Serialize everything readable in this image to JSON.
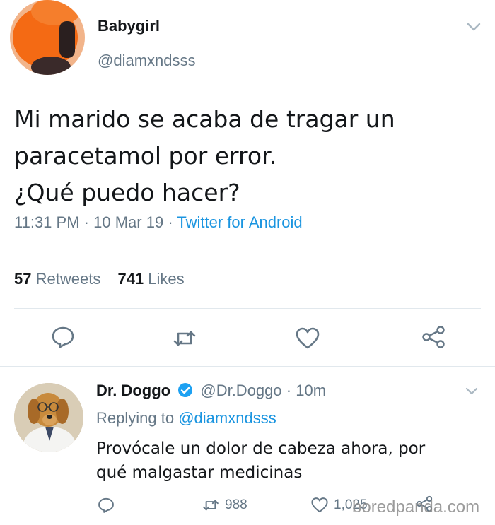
{
  "tweet": {
    "author_name": "Babygirl",
    "author_handle": "@diamxndsss",
    "text_lines": [
      "Mi marido se acaba de tragar un",
      "paracetamol por error.",
      "¿Qué puedo hacer?"
    ],
    "time": "11:31 PM",
    "date": "10 Mar 19",
    "source": "Twitter for Android",
    "separator": "·",
    "retweets_count": "57",
    "retweets_label": "Retweets",
    "likes_count": "741",
    "likes_label": "Likes",
    "avatar_icon": "profile-photo-redacted"
  },
  "actions": {
    "reply_icon": "reply-icon",
    "retweet_icon": "retweet-icon",
    "like_icon": "heart-icon",
    "share_icon": "share-icon"
  },
  "reply": {
    "author_name": "Dr. Doggo",
    "author_handle": "@Dr.Doggo",
    "time_ago": "10m",
    "separator": "·",
    "replying_prefix": "Replying to",
    "replying_mention": "@diamxndsss",
    "text_lines": [
      "Provócale un dolor de cabeza ahora, por",
      "qué malgastar medicinas"
    ],
    "retweets_count": "988",
    "likes_count": "1,025",
    "avatar_icon": "dog-doctor-photo"
  },
  "watermark": "boredpanda.com",
  "colors": {
    "text": "#14171a",
    "muted": "#657786",
    "link": "#1b95e0",
    "divider": "#e1e8ed",
    "verified": "#1da1f2",
    "redaction": "#f46a14"
  }
}
